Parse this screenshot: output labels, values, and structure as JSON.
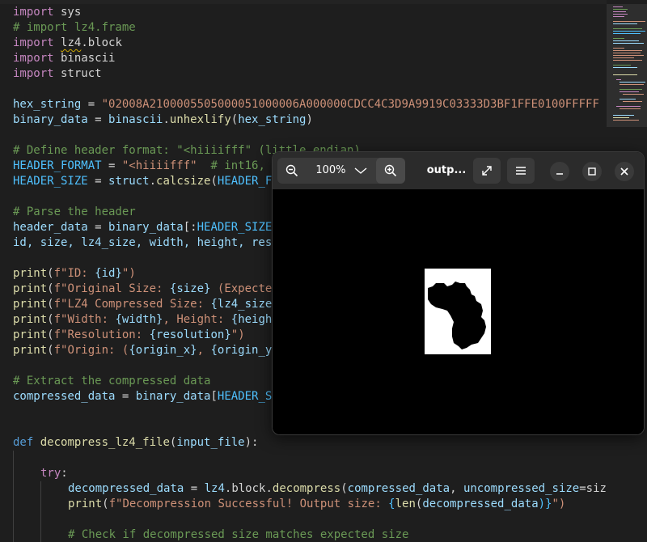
{
  "editor": {
    "line_1": {
      "t0": "import",
      "t1": " sys"
    },
    "line_2": {
      "t0": "# import lz4.frame"
    },
    "line_3": {
      "t0": "import",
      "t1": " ",
      "t2": "lz4",
      "t3": ".block"
    },
    "line_4": {
      "t0": "import",
      "t1": " binascii"
    },
    "line_5": {
      "t0": "import",
      "t1": " struct"
    },
    "line_7": {
      "t0": "hex_string",
      "t1": " = ",
      "t2": "\"02008A2100005505000051000006A000000CDCC4C3D9A9919C03333D3BF1FFE0100FFFFF"
    },
    "line_8": {
      "t0": "binary_data",
      "t1": " = ",
      "t2": "binascii",
      "t3": ".",
      "t4": "unhexlify",
      "t5": "(",
      "t6": "hex_string",
      "t7": ")"
    },
    "line_10": {
      "t0": "# Define header format: \"<hiiiifff\" (little endian)"
    },
    "line_11": {
      "t0": "HEADER_FORMAT",
      "t1": " = ",
      "t2": "\"<hiiiifff\"",
      "t3": "  # int16,"
    },
    "line_12": {
      "t0": "HEADER_SIZE",
      "t1": " = ",
      "t2": "struct",
      "t3": ".",
      "t4": "calcsize",
      "t5": "(",
      "t6": "HEADER_F"
    },
    "line_14": {
      "t0": "# Parse the header"
    },
    "line_15": {
      "t0": "header_data",
      "t1": " = ",
      "t2": "binary_data",
      "t3": "[:",
      "t4": "HEADER_SIZE"
    },
    "line_16": {
      "t0": "id, size, lz4_size, width, height, res"
    },
    "line_18": {
      "t0": "print",
      "t1": "(",
      "t2": "f\"ID: ",
      "t3": "{id}",
      "t4": "\")"
    },
    "line_19": {
      "t0": "print",
      "t1": "(",
      "t2": "f\"Original Size: ",
      "t3": "{size}",
      "t4": " (Expecte"
    },
    "line_20": {
      "t0": "print",
      "t1": "(",
      "t2": "f\"LZ4 Compressed Size: ",
      "t3": "{lz4_size"
    },
    "line_21": {
      "t0": "print",
      "t1": "(",
      "t2": "f\"Width: ",
      "t3": "{width}",
      "t4": ", Height: ",
      "t5": "{heigh"
    },
    "line_22": {
      "t0": "print",
      "t1": "(",
      "t2": "f\"Resolution: ",
      "t3": "{resolution}",
      "t4": "\")"
    },
    "line_23": {
      "t0": "print",
      "t1": "(",
      "t2": "f\"Origin: (",
      "t3": "{origin_x}",
      "t4": ", ",
      "t5": "{origin_y"
    },
    "line_25": {
      "t0": "# Extract the compressed data"
    },
    "line_26": {
      "t0": "compressed_data",
      "t1": " = ",
      "t2": "binary_data",
      "t3": "[",
      "t4": "HEADER_S"
    },
    "line_29": {
      "t0": "def",
      "t1": " ",
      "t2": "decompress_lz4_file",
      "t3": "(",
      "t4": "input_file",
      "t5": "):"
    },
    "line_31": {
      "t0": "try",
      "t1": ":"
    },
    "line_32": {
      "t0": "decompressed_data",
      "t1": " = ",
      "t2": "lz4",
      "t3": ".block.",
      "t4": "decompress",
      "t5": "(",
      "t6": "compressed_data",
      "t7": ", ",
      "t8": "uncompressed_size",
      "t9": "=siz"
    },
    "line_33": {
      "t0": "print",
      "t1": "(",
      "t2": "f\"Decompression Successful! Output size: ",
      "t3": "{",
      "t4": "len",
      "t5": "(",
      "t6": "decompressed_data",
      "t7": ")}",
      "t8": "\")"
    },
    "line_35": {
      "t0": "# Check if decompressed size matches expected size"
    }
  },
  "viewer": {
    "zoom_level": "100%",
    "title": "outp...",
    "icons": {
      "zoom_out": "zoom-out-icon",
      "zoom_in": "zoom-in-icon",
      "dropdown": "chevron-down-icon",
      "fullscreen": "fullscreen-icon",
      "menu": "hamburger-menu-icon",
      "minimize": "minimize-icon",
      "maximize": "maximize-icon",
      "close": "close-icon"
    }
  },
  "colors": {
    "editor_bg": "#1e1e1e",
    "keyword": "#c586c0",
    "function": "#dcdcaa",
    "string": "#ce9178",
    "comment": "#6a9955",
    "variable": "#9cdcfe",
    "constant": "#4fc1ff",
    "viewer_header": "#2b2b2b"
  }
}
